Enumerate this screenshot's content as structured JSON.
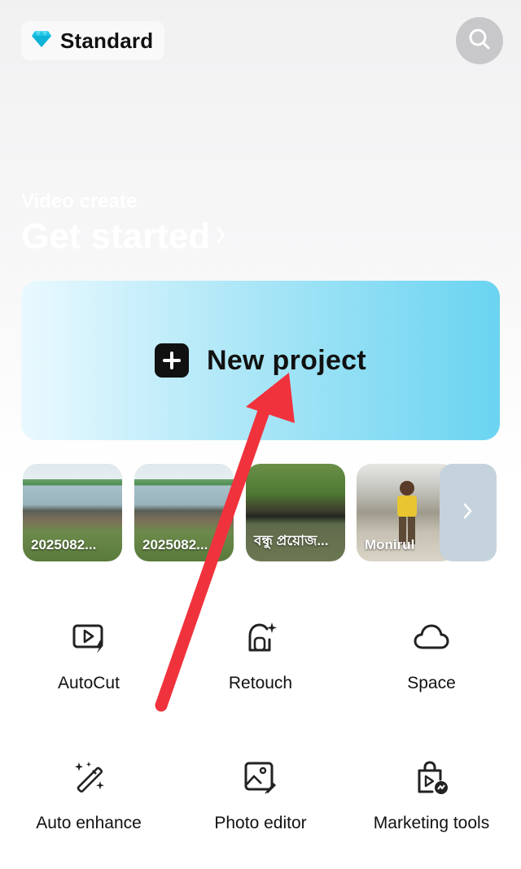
{
  "header": {
    "plan_label": "Standard",
    "plan_icon": "diamond-icon",
    "search_icon": "search-icon"
  },
  "hero": {
    "subtitle": "Video create",
    "title": "Get started",
    "chevron_icon": "chevron-right-icon"
  },
  "new_project": {
    "label": "New project",
    "icon": "plus-icon"
  },
  "recent_projects": [
    {
      "label": "2025082..."
    },
    {
      "label": "2025082..."
    },
    {
      "label": "বন্ধু প্রয়োজ..."
    },
    {
      "label": "Monirul"
    }
  ],
  "recent_more_icon": "chevron-right-icon",
  "tools": [
    {
      "label": "AutoCut",
      "icon": "autocut-icon"
    },
    {
      "label": "Retouch",
      "icon": "retouch-icon"
    },
    {
      "label": "Space",
      "icon": "cloud-icon"
    },
    {
      "label": "Auto enhance",
      "icon": "magic-wand-icon"
    },
    {
      "label": "Photo editor",
      "icon": "photo-edit-icon"
    },
    {
      "label": "Marketing tools",
      "icon": "shopping-bag-icon"
    }
  ],
  "colors": {
    "accent_cyan": "#6ad4f1",
    "diamond": "#1fc4e6",
    "annotation_arrow": "#f0323c"
  }
}
